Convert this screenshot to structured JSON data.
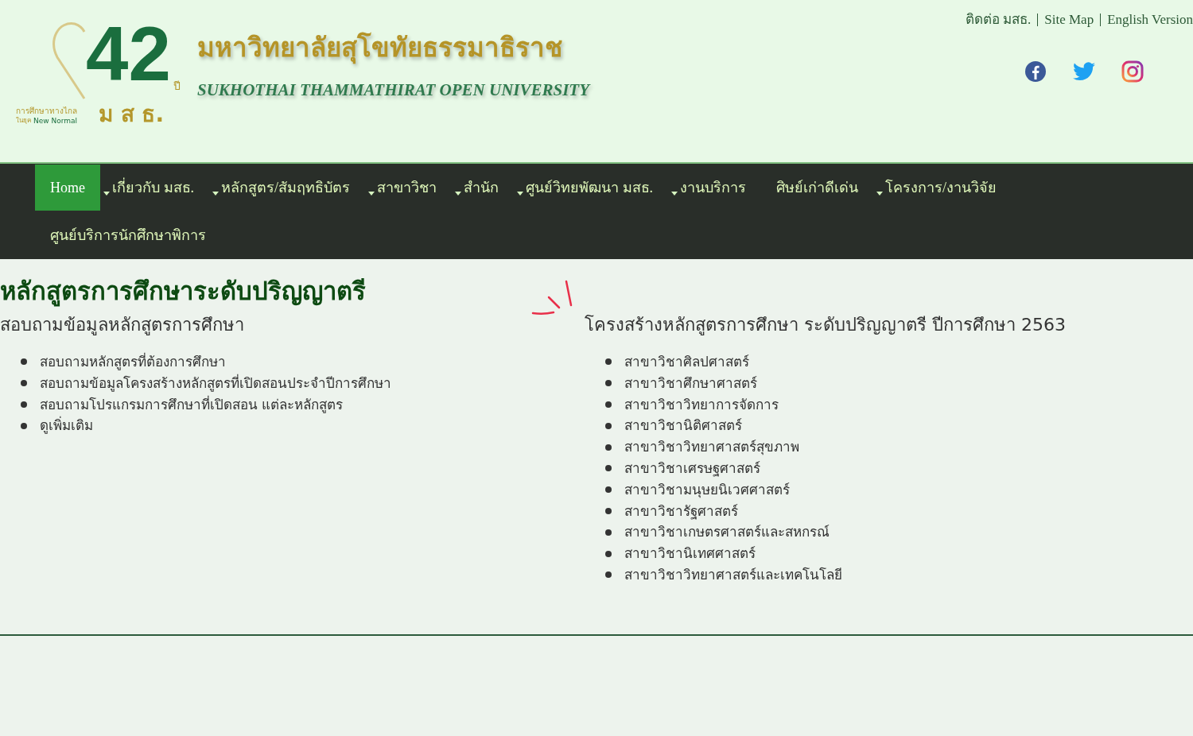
{
  "logo": {
    "number": "42",
    "year_mark": "ปี",
    "tagline_1": "การศึกษาทางไกล",
    "tagline_2_prefix": "ในยุค",
    "tagline_2": "New Normal",
    "initials": "ม ส ธ."
  },
  "university": {
    "name_th": "มหาวิทยาลัยสุโขทัยธรรมาธิราช",
    "name_en": "SUKHOTHAI THAMMATHIRAT OPEN UNIVERSITY"
  },
  "top_links": [
    "ติดต่อ มสธ.",
    "Site Map",
    "English Version"
  ],
  "social": [
    {
      "kind": "facebook"
    },
    {
      "kind": "twitter"
    },
    {
      "kind": "instagram"
    }
  ],
  "nav": [
    {
      "label": "Home",
      "selected": true,
      "has_dropdown": false
    },
    {
      "label": "เกี่ยวกับ มสธ.",
      "selected": false,
      "has_dropdown": true
    },
    {
      "label": "หลักสูตร/สัมฤทธิบัตร",
      "selected": false,
      "has_dropdown": true
    },
    {
      "label": "สาขาวิชา",
      "selected": false,
      "has_dropdown": true
    },
    {
      "label": "สำนัก",
      "selected": false,
      "has_dropdown": true
    },
    {
      "label": "ศูนย์วิทยพัฒนา มสธ.",
      "selected": false,
      "has_dropdown": true
    },
    {
      "label": "งานบริการ",
      "selected": false,
      "has_dropdown": true
    },
    {
      "label": "ศิษย์เก่าดีเด่น",
      "selected": false,
      "has_dropdown": false
    },
    {
      "label": "โครงการ/งานวิจัย",
      "selected": false,
      "has_dropdown": true
    },
    {
      "label": "ศูนย์บริการนักศึกษาพิการ",
      "selected": false,
      "has_dropdown": false
    }
  ],
  "page_title": "หลักสูตรการศึกษาระดับปริญญาตรี",
  "left_section": {
    "heading": "สอบถามข้อมูลหลักสูตรการศึกษา",
    "items": [
      "สอบถามหลักสูตรที่ต้องการศึกษา",
      "สอบถามข้อมูลโครงสร้างหลักสูตรที่เปิดสอนประจำปีการศึกษา",
      "สอบถามโปรแกรมการศึกษาที่เปิดสอน แต่ละหลักสูตร",
      "ดูเพิ่มเติม"
    ]
  },
  "right_section": {
    "heading": "โครงสร้างหลักสูตรการศึกษา ระดับปริญญาตรี ปีการศึกษา 2563",
    "items": [
      "สาขาวิชาศิลปศาสตร์",
      "สาขาวิชาศึกษาศาสตร์",
      "สาขาวิชาวิทยาการจัดการ",
      "สาขาวิชานิติศาสตร์",
      "สาขาวิชาวิทยาศาสตร์สุขภาพ",
      "สาขาวิชาเศรษฐศาสตร์",
      "สาขาวิชามนุษยนิเวศศาสตร์",
      "สาขาวิชารัฐศาสตร์",
      "สาขาวิชาเกษตรศาสตร์และสหกรณ์",
      "สาขาวิชานิเทศศาสตร์",
      "สาขาวิชาวิทยาศาสตร์และเทคโนโลยี"
    ]
  }
}
